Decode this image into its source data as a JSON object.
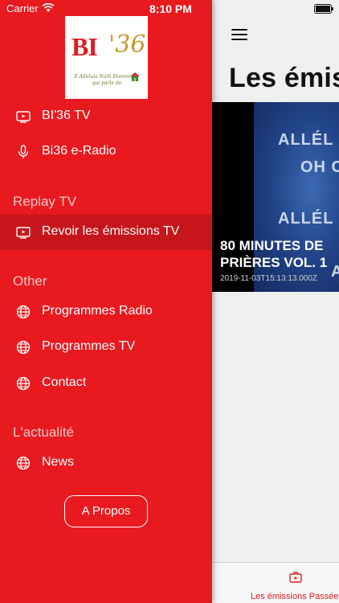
{
  "status_bar": {
    "carrier": "Carrier",
    "time": "8:10 PM"
  },
  "drawer": {
    "logo": {
      "brand_main": "BI",
      "brand_number": "'36",
      "tagline": "Il Alleluia Nath Dominique qui parle de"
    },
    "top_items": [
      {
        "label": "BI'36 TV",
        "icon": "tv-play-icon"
      },
      {
        "label": "Bi36 e-Radio",
        "icon": "microphone-icon"
      }
    ],
    "sections": {
      "replay": {
        "header": "Replay TV",
        "items": [
          {
            "label": "Revoir les émissions TV",
            "icon": "tv-play-icon",
            "active": true
          }
        ]
      },
      "other": {
        "header": "Other",
        "items": [
          {
            "label": "Programmes Radio",
            "icon": "globe-icon"
          },
          {
            "label": "Programmes TV",
            "icon": "globe-icon"
          },
          {
            "label": "Contact",
            "icon": "globe-icon"
          }
        ]
      },
      "news": {
        "header": "L'actualité",
        "items": [
          {
            "label": "News",
            "icon": "globe-icon"
          }
        ]
      }
    },
    "about_button": "A Propos"
  },
  "main": {
    "title": "Les émissions",
    "card": {
      "overlay_line1": "ALLÉL",
      "overlay_line2": "OH C",
      "overlay_line3": "ALLÉL",
      "overlay_line4": "A",
      "title": "80 MINUTES DE PRIÈRES VOL. 1",
      "date": "2019-11-03T15:13:13.000Z"
    },
    "tab": {
      "label": "Les émissions Passées",
      "icon": "tv-play-icon"
    }
  },
  "colors": {
    "drawer_bg": "#e8191f",
    "drawer_active": "#c7161b",
    "accent": "#d81e24"
  }
}
